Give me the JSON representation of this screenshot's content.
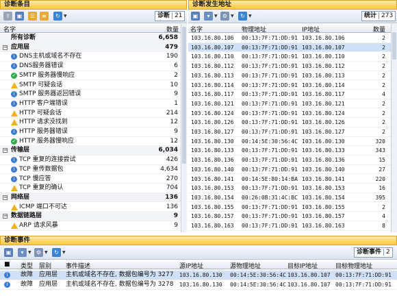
{
  "left_panel": {
    "title": "诊断条目",
    "badge_label": "诊断",
    "badge_count": "21",
    "col_name": "名字",
    "col_count": "数量",
    "rows": [
      {
        "kind": "total",
        "label": "所有诊断",
        "count": "6,658"
      },
      {
        "kind": "section",
        "label": "应用层",
        "count": "479"
      },
      {
        "kind": "item",
        "icon": "info",
        "label": "DNS主机或域名不存在",
        "count": "190"
      },
      {
        "kind": "item",
        "icon": "info",
        "label": "DNS服务器错误",
        "count": "6"
      },
      {
        "kind": "item",
        "icon": "ok",
        "label": "SMTP 服务器慢响应",
        "count": "2"
      },
      {
        "kind": "item",
        "icon": "warn",
        "label": "SMTP 可疑会话",
        "count": "10"
      },
      {
        "kind": "item",
        "icon": "info",
        "label": "SMTP 服务器返回错误",
        "count": "9"
      },
      {
        "kind": "item",
        "icon": "info",
        "label": "HTTP 客户端错误",
        "count": "1"
      },
      {
        "kind": "item",
        "icon": "warn",
        "label": "HTTP 可疑会话",
        "count": "214"
      },
      {
        "kind": "item",
        "icon": "warn",
        "label": "HTTP 请求没找到",
        "count": "12"
      },
      {
        "kind": "item",
        "icon": "info",
        "label": "HTTP 服务器错误",
        "count": "9"
      },
      {
        "kind": "item",
        "icon": "ok",
        "label": "HTTP 服务器慢响应",
        "count": "12"
      },
      {
        "kind": "section",
        "label": "传输层",
        "count": "6,034"
      },
      {
        "kind": "item",
        "icon": "info",
        "label": "TCP 重复的连接尝试",
        "count": "426"
      },
      {
        "kind": "item",
        "icon": "info",
        "label": "TCP 重传数据包",
        "count": "4,634"
      },
      {
        "kind": "item",
        "icon": "info",
        "label": "TCP 慢应答",
        "count": "270"
      },
      {
        "kind": "item",
        "icon": "warn",
        "label": "TCP 重复的确认",
        "count": "704"
      },
      {
        "kind": "section",
        "label": "网络层",
        "count": "136"
      },
      {
        "kind": "item",
        "icon": "warn",
        "label": "ICMP 端口不可达",
        "count": "136"
      },
      {
        "kind": "section",
        "label": "数据链路层",
        "count": "9"
      },
      {
        "kind": "item",
        "icon": "warn",
        "label": "ARP 请求风暴",
        "count": "9"
      }
    ]
  },
  "right_panel": {
    "title": "诊断发生地址",
    "badge_label": "统计",
    "badge_count": "273",
    "col_name": "名字",
    "col_mac": "物理地址",
    "col_ip": "IP地址",
    "col_count": "数量",
    "rows": [
      [
        "103.16.80.106",
        "00:13:7F:71:DD:91",
        "103.16.80.106",
        "2"
      ],
      [
        "103.16.80.107",
        "00:13:7F:71:DD:91",
        "103.16.80.107",
        "2"
      ],
      [
        "103.16.80.110",
        "00:13:7F:71:DD:91",
        "103.16.80.110",
        "2"
      ],
      [
        "103.16.80.112",
        "00:13:7F:71:DD:91",
        "103.16.80.112",
        "2"
      ],
      [
        "103.16.80.113",
        "00:13:7F:71:DD:91",
        "103.16.80.113",
        "2"
      ],
      [
        "103.16.80.114",
        "00:13:7F:71:DD:91",
        "103.16.80.114",
        "2"
      ],
      [
        "103.16.80.117",
        "00:13:7F:71:DD:91",
        "103.16.80.117",
        "4"
      ],
      [
        "103.16.80.121",
        "00:13:7F:71:DD:91",
        "103.16.80.121",
        "2"
      ],
      [
        "103.16.80.124",
        "00:13:7F:71:DD:91",
        "103.16.80.124",
        "2"
      ],
      [
        "103.16.80.126",
        "00:13:7F:71:DD:91",
        "103.16.80.126",
        "2"
      ],
      [
        "103.16.80.127",
        "00:13:7F:71:DD:91",
        "103.16.80.127",
        "2"
      ],
      [
        "103.16.80.130",
        "00:14:5E:30:56:4C",
        "103.16.80.130",
        "320"
      ],
      [
        "103.16.80.133",
        "00:13:7F:71:DD:91",
        "103.16.80.133",
        "343"
      ],
      [
        "103.16.80.136",
        "00:13:7F:71:DD:91",
        "103.16.80.136",
        "15"
      ],
      [
        "103.16.80.140",
        "00:13:7F:71:DD:91",
        "103.16.80.140",
        "27"
      ],
      [
        "103.16.80.141",
        "00:14:5E:80:14:BA",
        "103.16.80.141",
        "220"
      ],
      [
        "103.16.80.153",
        "00:13:7F:71:DD:91",
        "103.16.80.153",
        "16"
      ],
      [
        "103.16.80.154",
        "00:26:0B:31:4C:BC",
        "103.16.80.154",
        "395"
      ],
      [
        "103.16.80.155",
        "00:13:7F:71:DD:91",
        "103.16.80.155",
        "2"
      ],
      [
        "103.16.80.157",
        "00:13:7F:71:DD:91",
        "103.16.80.157",
        "4"
      ],
      [
        "103.16.80.163",
        "00:13:7F:71:DD:91",
        "103.16.80.163",
        "8"
      ]
    ]
  },
  "bottom_panel": {
    "title": "诊断事件",
    "badge_label": "诊断事件",
    "badge_count": "2",
    "cols": [
      "类型",
      "层别",
      "事件描述",
      "源IP地址",
      "源物理地址",
      "目标IP地址",
      "目标物理地址"
    ],
    "rows": [
      [
        "故障",
        "应用层",
        "主机或域名不存在, 数据包编号为 3277",
        "103.16.80.130",
        "00:14:5E:30:56:4C",
        "103.16.80.107",
        "00:13:7F:71:DD:91"
      ],
      [
        "故障",
        "应用层",
        "主机或域名不存在, 数据包编号为 3278",
        "103.16.80.130",
        "00:14:5E:30:56:4C",
        "103.16.80.107",
        "00:13:7F:71:DD:91"
      ]
    ]
  },
  "icons": [
    "export-icon",
    "save-icon",
    "tree-view-icon",
    "list-view-icon",
    "refresh-icon",
    "filter-icon",
    "settings-icon",
    "info-icon",
    "warning-icon",
    "ok-icon"
  ]
}
